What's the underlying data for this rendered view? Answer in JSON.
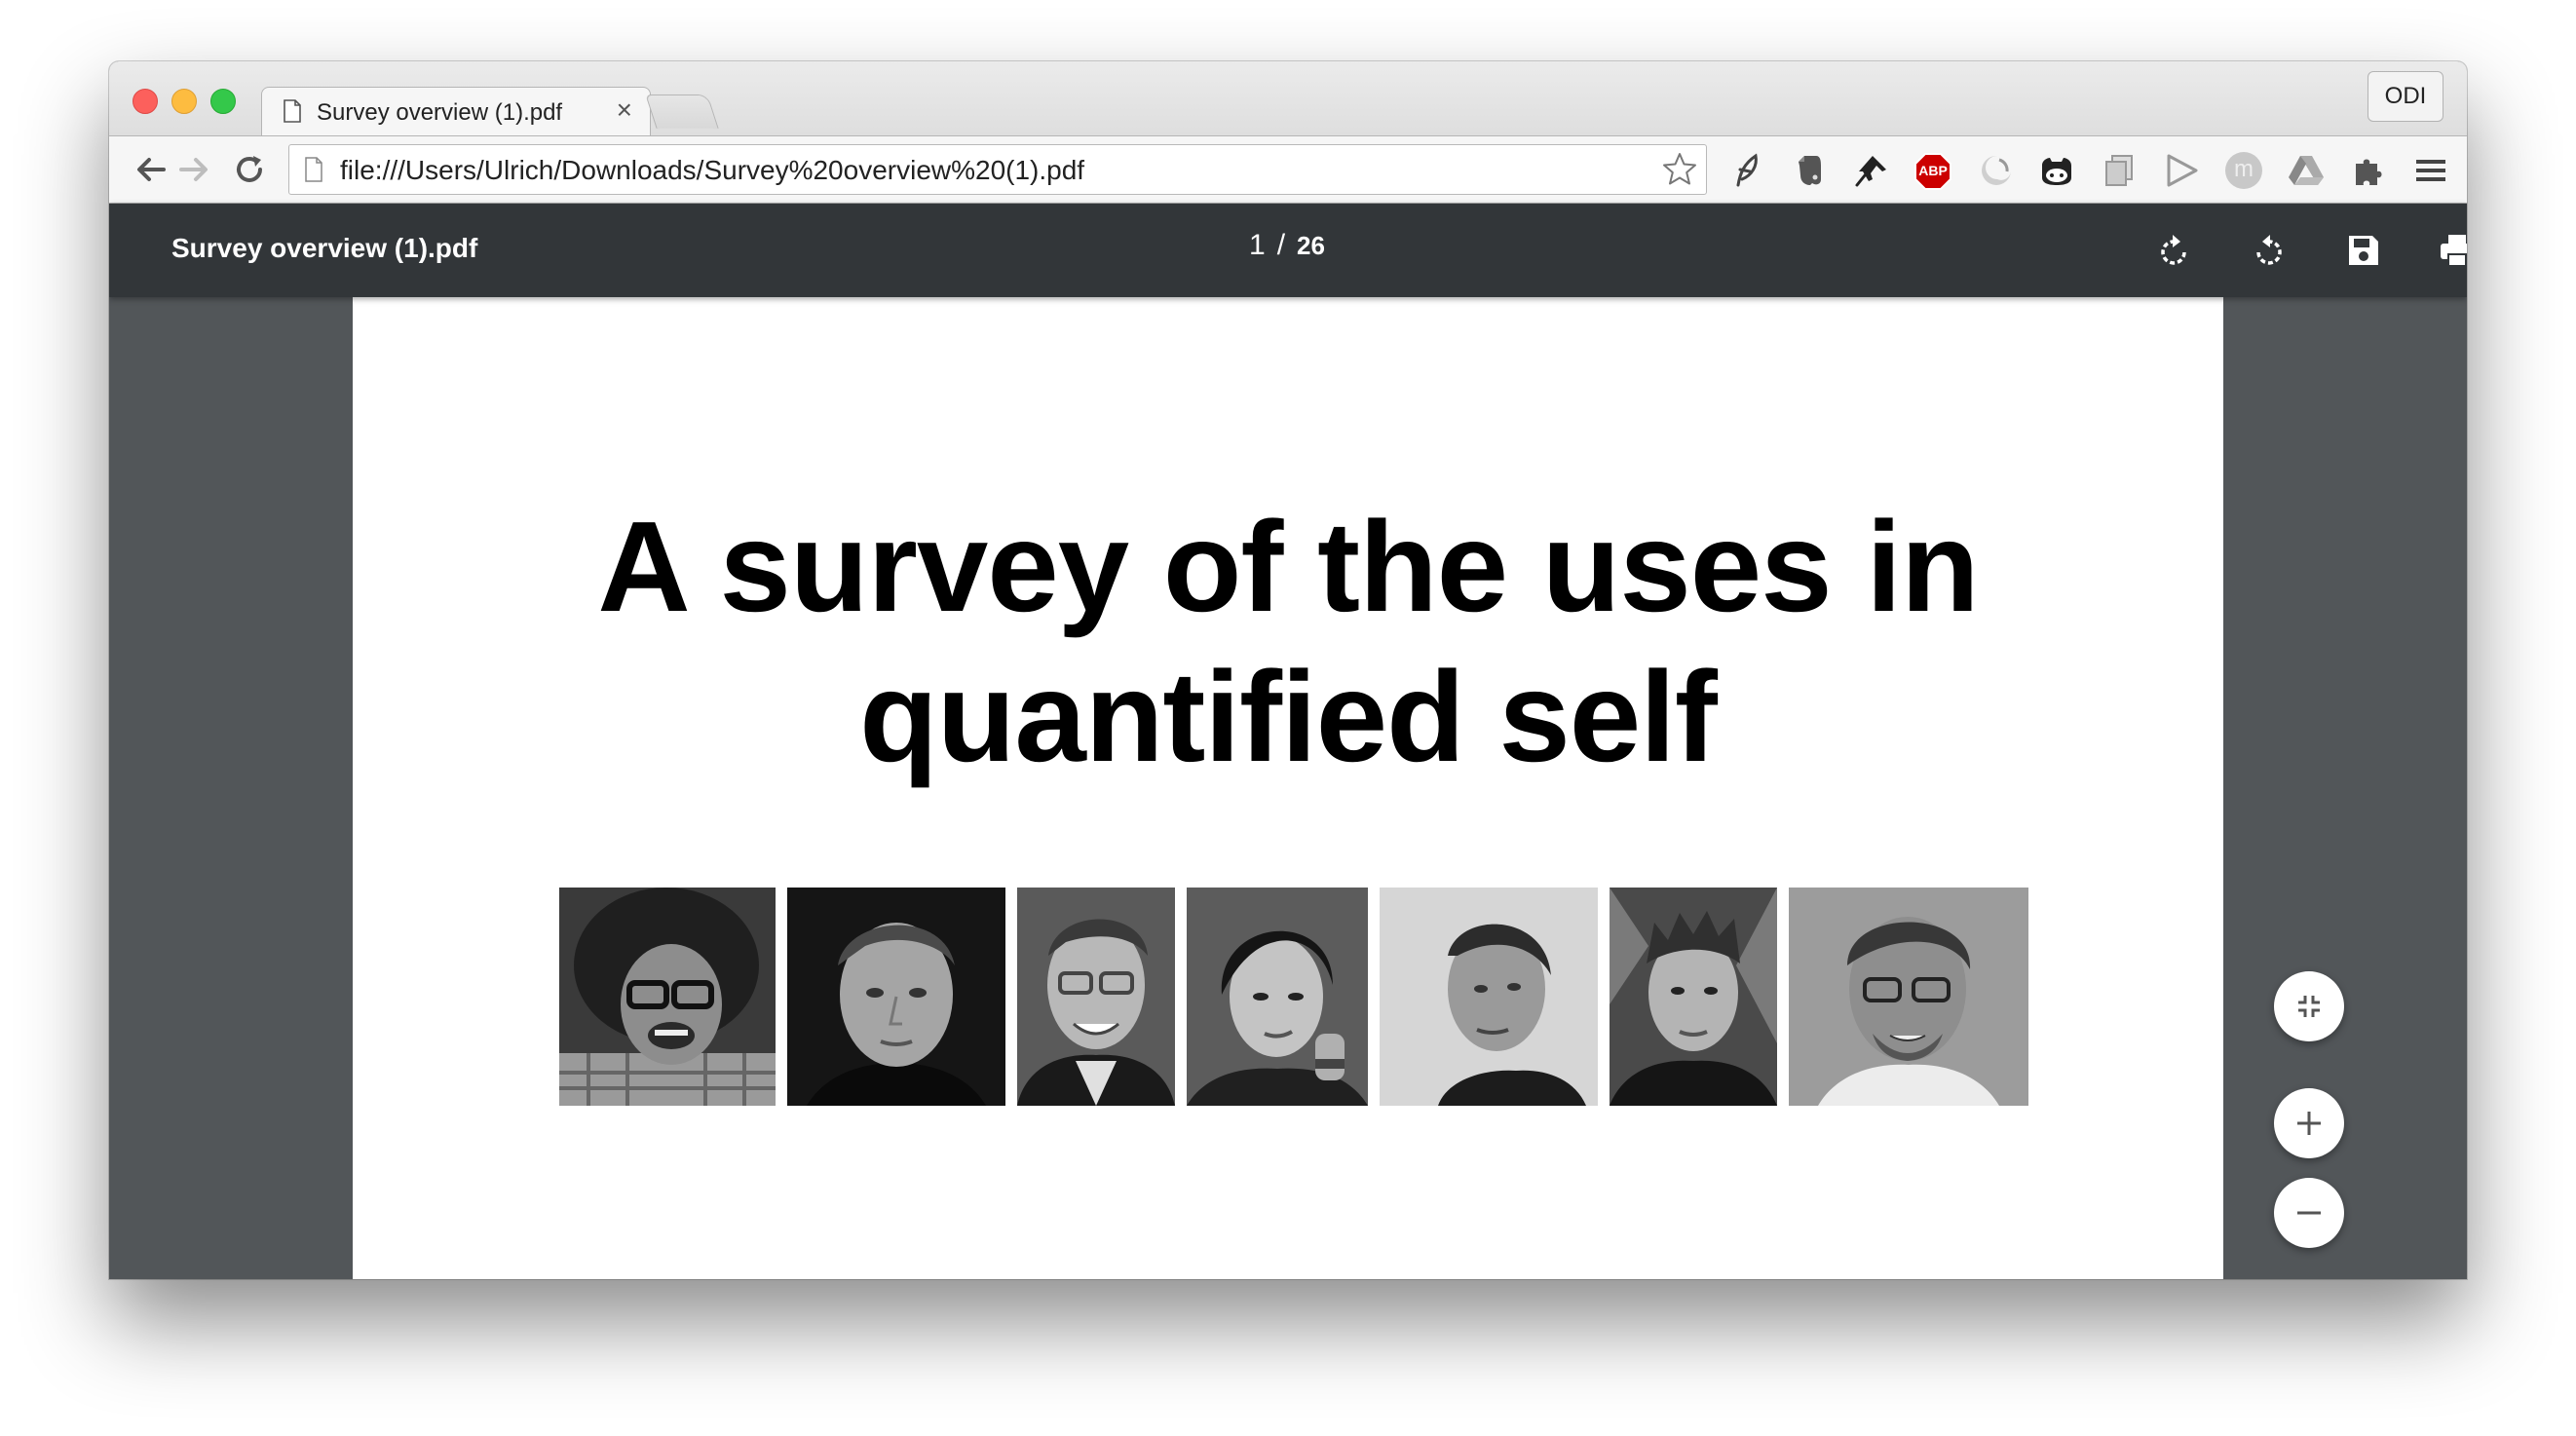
{
  "tab": {
    "title": "Survey overview (1).pdf",
    "close_glyph": "×",
    "icon": "file-icon"
  },
  "profile": {
    "label": "ODI"
  },
  "omnibox": {
    "url": "file:///Users/Ulrich/Downloads/Survey%20overview%20(1).pdf"
  },
  "toolbar": {
    "icons": [
      "back-icon",
      "forward-icon",
      "reload-icon",
      "star-icon"
    ],
    "extensions": [
      "feather-extension-icon",
      "evernote-extension-icon",
      "pin-extension-icon",
      "adblock-plus-icon",
      "swirl-extension-icon",
      "github-extension-icon",
      "copy-extension-icon",
      "play-extension-icon",
      "m-extension-icon",
      "drive-extension-icon",
      "puzzle-extension-icon",
      "menu-icon"
    ],
    "adblock_label": "ABP",
    "m_label": "m"
  },
  "pdf": {
    "title": "Survey overview (1).pdf",
    "current_page": "1",
    "separator": "/",
    "total_pages": "26",
    "tools": [
      "rotate-clockwise-icon",
      "rotate-counterclockwise-icon",
      "save-icon",
      "print-icon"
    ]
  },
  "document": {
    "title_line1": "A survey of the uses in",
    "title_line2": "quantified self",
    "photos": [
      "person-photo-1",
      "person-photo-2",
      "person-photo-3",
      "person-photo-4",
      "person-photo-5",
      "person-photo-6",
      "person-photo-7"
    ]
  },
  "zoom": {
    "controls": [
      "fit-to-page-icon",
      "zoom-in-icon",
      "zoom-out-icon"
    ]
  },
  "colors": {
    "pdf_toolbar": "#323639",
    "viewer_bg": "#525659",
    "adblock_red": "#cc0000"
  }
}
